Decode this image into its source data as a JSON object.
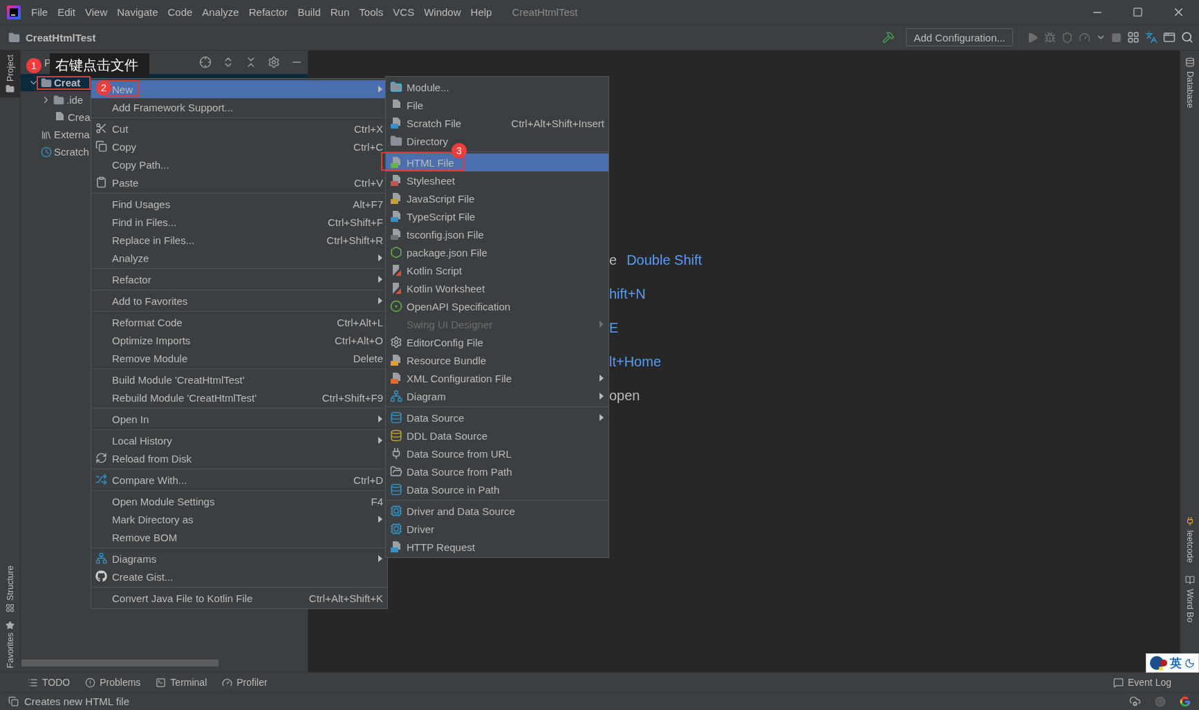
{
  "window": {
    "title": "CreatHtmlTest"
  },
  "menu_bar": [
    "File",
    "Edit",
    "View",
    "Navigate",
    "Code",
    "Analyze",
    "Refactor",
    "Build",
    "Run",
    "Tools",
    "VCS",
    "Window",
    "Help"
  ],
  "nav_bar": {
    "breadcrumb": "CreatHtmlTest",
    "run_config": "Add Configuration..."
  },
  "left_stripe": [
    {
      "label": "Project",
      "selected": true
    },
    {
      "label": "Structure",
      "selected": false
    },
    {
      "label": "Favorites",
      "selected": false
    }
  ],
  "project_panel": {
    "title": "P",
    "tree": [
      {
        "label": "Creat",
        "expanded": true,
        "selected": true,
        "children": [
          {
            "label": ".ide",
            "expanded": false,
            "selected": false
          },
          {
            "label": "Crea",
            "selected": false
          }
        ]
      },
      {
        "label": "Externa",
        "selected": false
      },
      {
        "label": "Scratch",
        "selected": false
      }
    ]
  },
  "context_menu": {
    "groups": [
      [
        {
          "label": "New",
          "selected": true,
          "has_submenu": true
        },
        {
          "label": "Add Framework Support...",
          "selected": false
        }
      ],
      [
        {
          "label": "Cut",
          "shortcut": "Ctrl+X",
          "selected": false
        },
        {
          "label": "Copy",
          "shortcut": "Ctrl+C",
          "selected": false
        },
        {
          "label": "Copy Path...",
          "selected": false
        },
        {
          "label": "Paste",
          "shortcut": "Ctrl+V",
          "selected": false
        }
      ],
      [
        {
          "label": "Find Usages",
          "shortcut": "Alt+F7",
          "selected": false
        },
        {
          "label": "Find in Files...",
          "shortcut": "Ctrl+Shift+F",
          "selected": false
        },
        {
          "label": "Replace in Files...",
          "shortcut": "Ctrl+Shift+R",
          "selected": false
        },
        {
          "label": "Analyze",
          "selected": false,
          "has_submenu": true
        }
      ],
      [
        {
          "label": "Refactor",
          "selected": false,
          "has_submenu": true
        }
      ],
      [
        {
          "label": "Add to Favorites",
          "selected": false,
          "has_submenu": true
        }
      ],
      [
        {
          "label": "Reformat Code",
          "shortcut": "Ctrl+Alt+L",
          "selected": false
        },
        {
          "label": "Optimize Imports",
          "shortcut": "Ctrl+Alt+O",
          "selected": false
        },
        {
          "label": "Remove Module",
          "shortcut": "Delete",
          "selected": false
        }
      ],
      [
        {
          "label": "Build Module 'CreatHtmlTest'",
          "selected": false
        },
        {
          "label": "Rebuild Module 'CreatHtmlTest'",
          "shortcut": "Ctrl+Shift+F9",
          "selected": false
        }
      ],
      [
        {
          "label": "Open In",
          "selected": false,
          "has_submenu": true
        }
      ],
      [
        {
          "label": "Local History",
          "selected": false,
          "has_submenu": true
        },
        {
          "label": "Reload from Disk",
          "selected": false
        }
      ],
      [
        {
          "label": "Compare With...",
          "shortcut": "Ctrl+D",
          "selected": false
        }
      ],
      [
        {
          "label": "Open Module Settings",
          "shortcut": "F4",
          "selected": false
        },
        {
          "label": "Mark Directory as",
          "selected": false,
          "has_submenu": true
        },
        {
          "label": "Remove BOM",
          "selected": false
        }
      ],
      [
        {
          "label": "Diagrams",
          "selected": false,
          "has_submenu": true
        },
        {
          "label": "Create Gist...",
          "selected": false
        }
      ],
      [
        {
          "label": "Convert Java File to Kotlin File",
          "shortcut": "Ctrl+Alt+Shift+K",
          "selected": false
        }
      ]
    ]
  },
  "new_submenu": {
    "groups": [
      [
        {
          "label": "Module...",
          "selected": false,
          "disabled": false
        },
        {
          "label": "File",
          "selected": false,
          "disabled": false
        },
        {
          "label": "Scratch File",
          "shortcut": "Ctrl+Alt+Shift+Insert",
          "selected": false,
          "disabled": false
        },
        {
          "label": "Directory",
          "selected": false,
          "disabled": false
        }
      ],
      [
        {
          "label": "HTML File",
          "selected": true,
          "disabled": false
        },
        {
          "label": "Stylesheet",
          "selected": false,
          "disabled": false
        },
        {
          "label": "JavaScript File",
          "selected": false,
          "disabled": false
        },
        {
          "label": "TypeScript File",
          "selected": false,
          "disabled": false
        },
        {
          "label": "tsconfig.json File",
          "selected": false,
          "disabled": false
        },
        {
          "label": "package.json File",
          "selected": false,
          "disabled": false
        },
        {
          "label": "Kotlin Script",
          "selected": false,
          "disabled": false
        },
        {
          "label": "Kotlin Worksheet",
          "selected": false,
          "disabled": false
        },
        {
          "label": "OpenAPI Specification",
          "selected": false,
          "disabled": false
        },
        {
          "label": "Swing UI Designer",
          "selected": false,
          "disabled": true,
          "has_submenu": true
        },
        {
          "label": "EditorConfig File",
          "selected": false,
          "disabled": false
        },
        {
          "label": "Resource Bundle",
          "selected": false,
          "disabled": false
        },
        {
          "label": "XML Configuration File",
          "selected": false,
          "disabled": false,
          "has_submenu": true
        },
        {
          "label": "Diagram",
          "selected": false,
          "disabled": false,
          "has_submenu": true
        }
      ],
      [
        {
          "label": "Data Source",
          "selected": false,
          "disabled": false,
          "has_submenu": true
        },
        {
          "label": "DDL Data Source",
          "selected": false,
          "disabled": false
        },
        {
          "label": "Data Source from URL",
          "selected": false,
          "disabled": false
        },
        {
          "label": "Data Source from Path",
          "selected": false,
          "disabled": false
        },
        {
          "label": "Data Source in Path",
          "selected": false,
          "disabled": false
        }
      ],
      [
        {
          "label": "Driver and Data Source",
          "selected": false,
          "disabled": false
        },
        {
          "label": "Driver",
          "selected": false,
          "disabled": false
        },
        {
          "label": "HTTP Request",
          "selected": false,
          "disabled": false
        }
      ]
    ]
  },
  "editor_hints": [
    {
      "text": "e",
      "shortcut": "Double Shift"
    },
    {
      "shortcut": "hift+N"
    },
    {
      "shortcut": "E"
    },
    {
      "shortcut": "lt+Home"
    },
    {
      "text": "open"
    }
  ],
  "right_stripe": [
    "Database",
    "leetcode",
    "Word Bo"
  ],
  "annotations": {
    "tooltip": "右键点击文件",
    "markers": [
      "1",
      "2",
      "3"
    ]
  },
  "tool_windows": [
    "TODO",
    "Problems",
    "Terminal",
    "Profiler"
  ],
  "event_log": "Event Log",
  "ime_widget": {
    "label": "英"
  },
  "status_bar": {
    "text": "Creates new HTML file"
  }
}
